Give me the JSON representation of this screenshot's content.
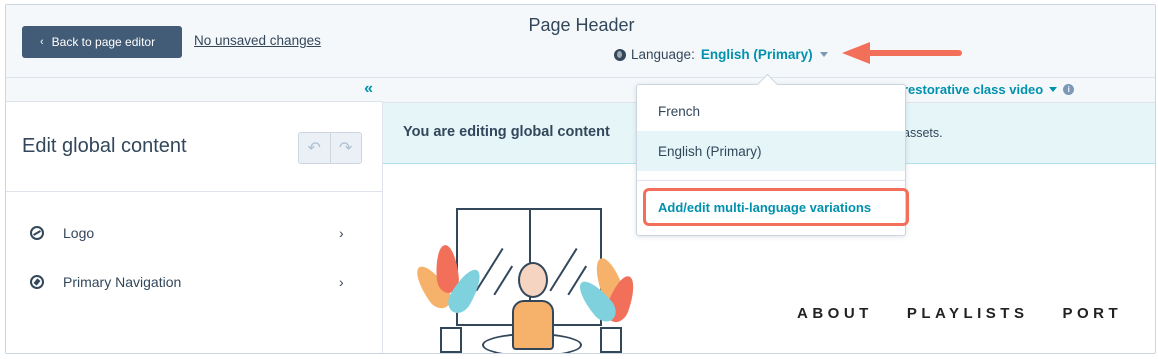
{
  "header": {
    "back_label": "Back to page editor",
    "unsaved_label": "No unsaved changes",
    "page_title": "Page Header",
    "language_label": "Language:",
    "language_value": "English (Primary)"
  },
  "sidebar": {
    "collapse_glyph": "«",
    "title": "Edit global content",
    "undo_glyph": "↶",
    "redo_glyph": "↷",
    "items": [
      {
        "label": "Logo",
        "icon": "logo-icon"
      },
      {
        "label": "Primary Navigation",
        "icon": "compass-icon"
      }
    ]
  },
  "main": {
    "video_link": "restorative class video",
    "info_glyph": "i",
    "banner_text": "You are editing global content",
    "banner_tail": "assets.",
    "site_nav": [
      "ABOUT",
      "PLAYLISTS",
      "PORT"
    ]
  },
  "dropdown": {
    "options": [
      {
        "label": "French",
        "selected": false
      },
      {
        "label": "English (Primary)",
        "selected": true
      }
    ],
    "action_label": "Add/edit multi-language variations"
  },
  "colors": {
    "accent_teal": "#0091ae",
    "callout_coral": "#f2705a",
    "button_dark": "#425b76"
  }
}
